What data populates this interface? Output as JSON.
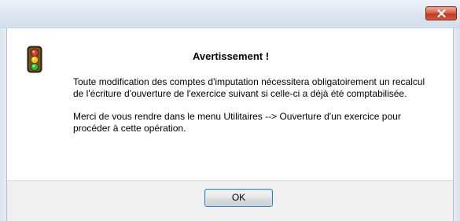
{
  "window": {
    "close_glyph": "close-icon",
    "accent_close": "#c2391f"
  },
  "dialog": {
    "icon": "traffic-light-icon",
    "heading": "Avertissement !",
    "message_1_line_1": "Toute modification des comptes d'imputation nécessitera obligatoirement un recalcul",
    "message_1_line_2": "de l'écriture d'ouverture de l'exercice suivant si celle-ci a déjà été comptabilisée.",
    "message_2_line_1": "Merci de vous rendre dans le menu Utilitaires --> Ouverture d'un exercice pour",
    "message_2_line_2": "procéder à cette opération."
  },
  "buttons": {
    "ok_label": "OK"
  }
}
